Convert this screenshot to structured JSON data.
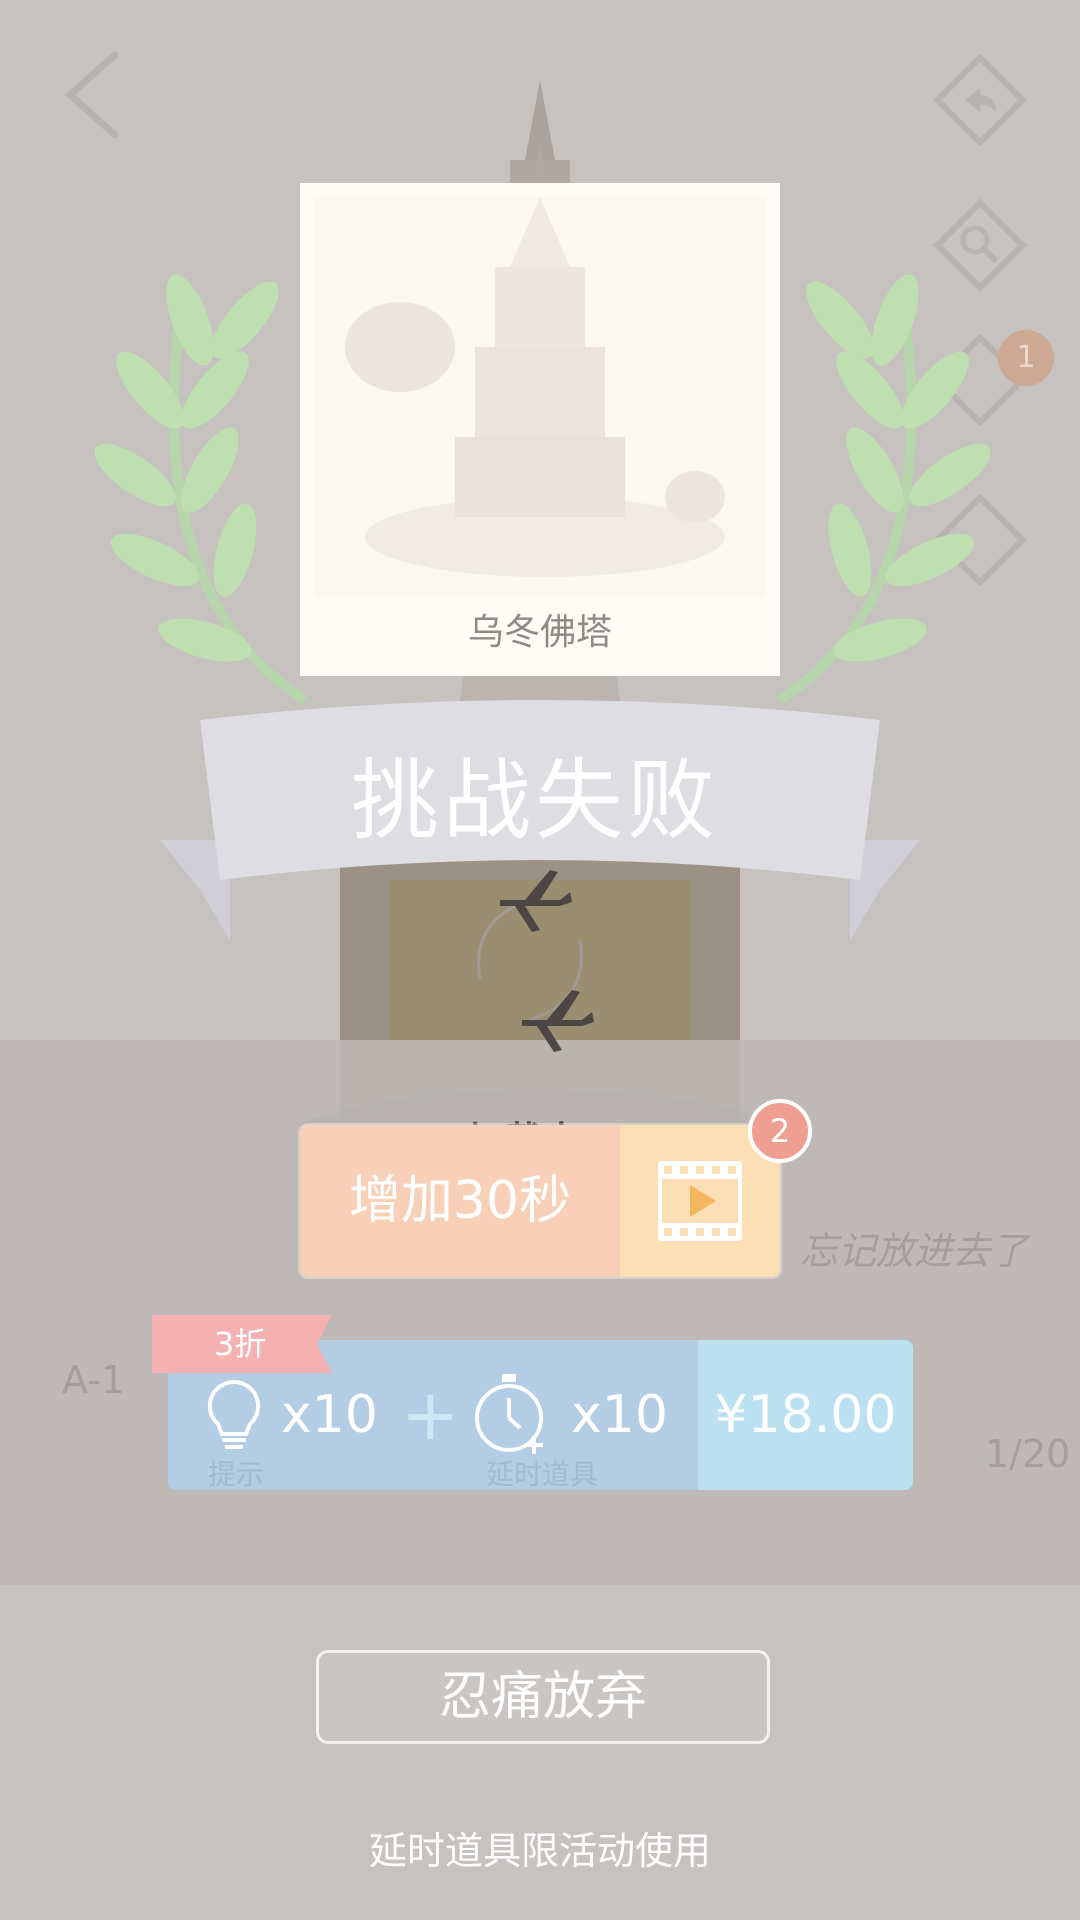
{
  "photo_card": {
    "caption": "乌冬佛塔"
  },
  "ribbon": {
    "title": "挑战失败"
  },
  "loading": {
    "text": "加载中..."
  },
  "add_time": {
    "label": "增加30秒",
    "badge_count": "2",
    "icon": "video-play-icon"
  },
  "bundle": {
    "discount_tag": "3折",
    "hint": {
      "icon": "lightbulb-icon",
      "count": "x10",
      "label": "提示"
    },
    "plus": "+",
    "timer": {
      "icon": "stopwatch-add-icon",
      "count": "x10",
      "label": "延时道具"
    },
    "price": "¥18.00"
  },
  "give_up": {
    "label": "忍痛放弃"
  },
  "footer_note": "延时道具限活动使用",
  "background": {
    "level_code": "A-1",
    "progress": "1/20",
    "hint_text": "忘记放进去了",
    "nav_badge": "1"
  },
  "colors": {
    "overlay": "#c6c2c0",
    "add_time_button": "#f8d0b8",
    "video_area": "#fddfb5",
    "bundle_button": "#b2cde4",
    "price_area": "#bbe1f1",
    "discount_tag": "#f3b1b2",
    "badge": "#ee9f92"
  }
}
